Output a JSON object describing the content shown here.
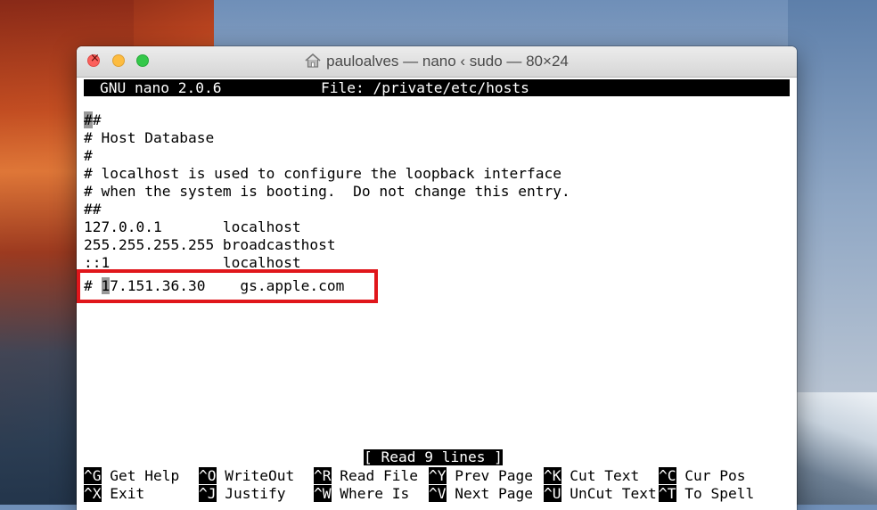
{
  "window": {
    "title": "paulo​alves — nano ‹ sudo — 80×24"
  },
  "nano": {
    "version": "GNU nano 2.0.6",
    "file": "File: /private/etc/hosts",
    "lines": [
      "##",
      "# Host Database",
      "#",
      "# localhost is used to configure the loopback interface",
      "# when the system is booting.  Do not change this entry.",
      "##",
      "127.0.0.1       localhost",
      "255.255.255.255 broadcasthost",
      "::1             localhost"
    ],
    "edited_line_prefix": "# ",
    "edited_line_cursor_char": "1",
    "edited_line_rest": "7.151.36.30    gs.apple.com",
    "status": "[ Read 9 lines ]",
    "shortcuts": [
      {
        "key": "^G",
        "label": "Get Help"
      },
      {
        "key": "^O",
        "label": "WriteOut"
      },
      {
        "key": "^R",
        "label": "Read File"
      },
      {
        "key": "^Y",
        "label": "Prev Page"
      },
      {
        "key": "^K",
        "label": "Cut Text"
      },
      {
        "key": "^C",
        "label": "Cur Pos"
      },
      {
        "key": "^X",
        "label": "Exit"
      },
      {
        "key": "^J",
        "label": "Justify"
      },
      {
        "key": "^W",
        "label": "Where Is"
      },
      {
        "key": "^V",
        "label": "Next Page"
      },
      {
        "key": "^U",
        "label": "UnCut Text"
      },
      {
        "key": "^T",
        "label": "To Spell"
      }
    ]
  },
  "colors": {
    "highlight_box": "#e0161b",
    "close": "#fc605c",
    "minimize": "#fdbc40",
    "zoom": "#34c84a"
  }
}
